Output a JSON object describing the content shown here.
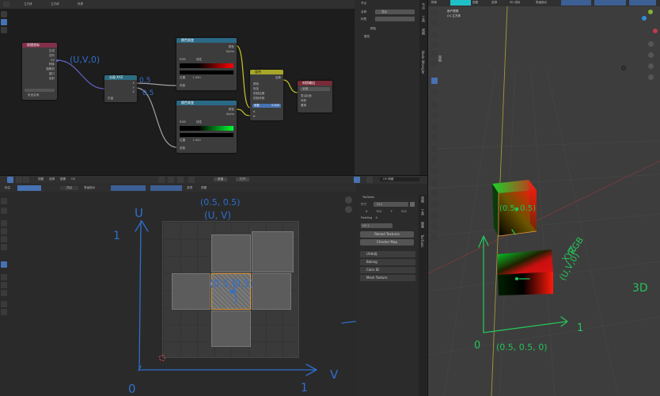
{
  "node_editor": {
    "header": {
      "object_label": "立方体",
      "material_label": "立方体",
      "mat_label": "材质"
    },
    "nodes": {
      "texcoord": {
        "title": "纹理坐标",
        "outputs": [
          "生成",
          "法向",
          "UV",
          "物体",
          "摄像机",
          "窗口",
          "反射"
        ],
        "from_instancer": "来自实例"
      },
      "separate": {
        "title": "分离 XYZ",
        "outputs": [
          "X",
          "Y",
          "Z"
        ],
        "input": "矢量"
      },
      "ramp1": {
        "title": "颜色渐变",
        "outputs": [
          "颜色",
          "Alpha"
        ],
        "mode": "RGB",
        "interp": "线性",
        "pos_label": "位置",
        "pos_value": "1.000",
        "fac": "系数"
      },
      "ramp2": {
        "title": "颜色渐变",
        "outputs": [
          "颜色",
          "Alpha"
        ],
        "mode": "RGB",
        "interp": "线性",
        "pos_label": "位置",
        "pos_value": "1.000",
        "fac": "系数"
      },
      "mix": {
        "title": "混合",
        "output": "结果",
        "rows": [
          "颜色",
          "相加",
          "钳制结果",
          "钳制系数"
        ],
        "fac_label": "系数",
        "fac_value": "0.500",
        "inputs": [
          "A",
          "B"
        ]
      },
      "output": {
        "title": "材质输出",
        "target": "全部",
        "inputs": [
          "表(曲)面",
          "体积",
          "置换"
        ]
      }
    },
    "annotations": {
      "uv0": "(U,V,0)",
      "a1": "0.5",
      "a2": "0.5"
    },
    "sidebar": {
      "node_tab": "节点",
      "name_label": "名称",
      "name_value": "混合",
      "label_label": "标签",
      "color_label": "颜色",
      "props_label": "属性"
    },
    "vtabs": [
      "节点",
      "工具",
      "视图",
      "Node Wrangler"
    ]
  },
  "uv_editor": {
    "menu": [
      "视图",
      "选择",
      "图像",
      "UV"
    ],
    "header2": {
      "sync": "同步",
      "snap": "顶点",
      "new_label": "新建",
      "open_label": "打开",
      "image_name": "UV 网格"
    },
    "subheader": {
      "mode": "标注",
      "mode2": "顶点",
      "sticky": "笔画指示",
      "opt1": "选项",
      "opt2": "视图"
    },
    "hand": {
      "u": "U",
      "v": "V",
      "o": "0",
      "one_x": "1",
      "one_y": "1",
      "top": "(0.5, 0.5)",
      "top2": "(U, V)",
      "center": "(0.5, 0.5)"
    }
  },
  "textools": {
    "title": "TexTools",
    "size_label": "尺寸",
    "size_value": "512",
    "x_label": "X",
    "x_value": "512",
    "y_label": "Y",
    "y_value": "512",
    "padding_label": "Padding",
    "padding_value": "4",
    "channel": "UV 1",
    "reload": "Reload Textures",
    "checker": "Checker Map",
    "sections": [
      "UV布局",
      "Baking",
      "Color ID",
      "Mesh Texture"
    ],
    "vtabs": [
      "视图",
      "工具",
      "图像",
      "TexTools"
    ]
  },
  "viewport": {
    "header": {
      "mode": "物体",
      "view": "视图",
      "select": "选择",
      "add": "添加",
      "object": "物体",
      "pivot": "3D 游标",
      "proportional": "笔画指示"
    },
    "overlay": {
      "line1": "用户透视",
      "line2": "(1) 立方体"
    },
    "vtabs": [
      "视图",
      "工具",
      "物体"
    ],
    "hand": {
      "p1": "(0.5, 0.5)",
      "rgb": "RGB",
      "xyz": "XYZ",
      "uv0": "(U,V,0)",
      "three_d": "3D",
      "zero": "0",
      "one": "1",
      "bottom": "(0.5, 0.5, 0)"
    }
  },
  "colors": {
    "accent": "#4772b3",
    "teal": "#1fc0c8",
    "blue_pen": "#2f6fcf",
    "green_pen": "#26c25a"
  }
}
